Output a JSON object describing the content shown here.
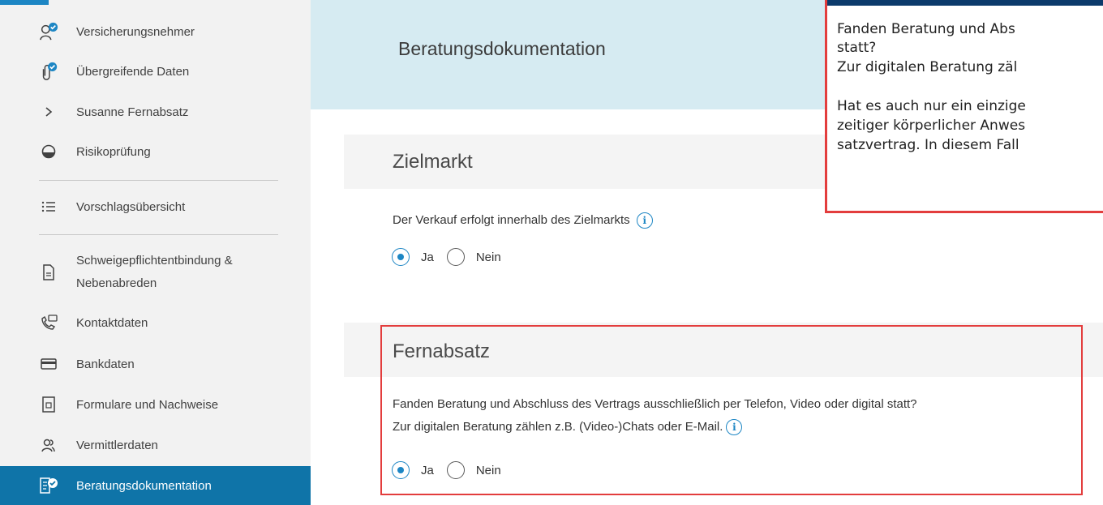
{
  "sidebar": {
    "items": [
      {
        "label": "Versicherungsnehmer",
        "icon": "person-check-icon"
      },
      {
        "label": "Übergreifende Daten",
        "icon": "paperclip-check-icon"
      },
      {
        "label": "Susanne Fernabsatz",
        "icon": "chevron-right-icon"
      },
      {
        "label": "Risikoprüfung",
        "icon": "circle-half-icon"
      },
      {
        "label": "Vorschlagsübersicht",
        "icon": "list-icon"
      },
      {
        "label": "Schweigepflichtentbindung &",
        "label2": "Nebenabreden",
        "icon": "document-icon"
      },
      {
        "label": "Kontaktdaten",
        "icon": "phone-message-icon"
      },
      {
        "label": "Bankdaten",
        "icon": "credit-card-icon"
      },
      {
        "label": "Formulare und Nachweise",
        "icon": "form-icon"
      },
      {
        "label": "Vermittlerdaten",
        "icon": "people-icon"
      },
      {
        "label": "Beratungsdokumentation",
        "icon": "document-check-icon"
      }
    ]
  },
  "page": {
    "title": "Beratungsdokumentation"
  },
  "zielmarkt": {
    "title": "Zielmarkt",
    "question": "Der Verkauf erfolgt innerhalb des Zielmarkts",
    "options": {
      "yes": "Ja",
      "no": "Nein"
    },
    "selected": "Ja"
  },
  "fernabsatz": {
    "title": "Fernabsatz",
    "question_line1": "Fanden Beratung und Abschluss des Vertrags ausschließlich per Telefon, Video oder digital statt?",
    "question_line2": "Zur digitalen Beratung zählen z.B. (Video-)Chats oder E-Mail.",
    "options": {
      "yes": "Ja",
      "no": "Nein"
    },
    "selected": "Ja"
  },
  "popup": {
    "line1": "Fanden Beratung und Abs",
    "line2": "statt?",
    "line3": "Zur digitalen Beratung zäl",
    "line4": "Hat es auch nur ein einzige",
    "line5": "zeitiger körperlicher Anwes",
    "line6": "satzvertrag. In diesem Fall"
  },
  "colors": {
    "accent": "#1d86c4",
    "active_nav": "#0f74a8",
    "highlight": "#e33d3d",
    "header_band": "#d6ebf2"
  }
}
